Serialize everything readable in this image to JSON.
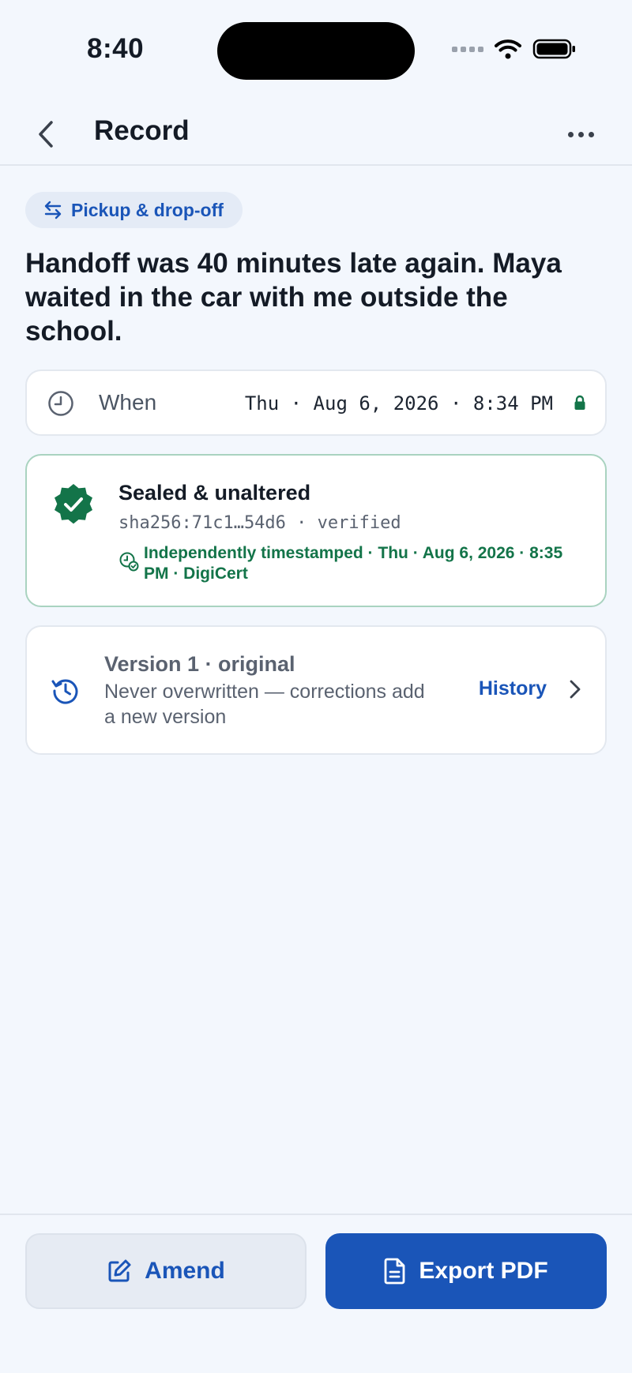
{
  "status_bar": {
    "time": "8:40"
  },
  "nav": {
    "title": "Record"
  },
  "record": {
    "category": "Pickup & drop-off",
    "headline": "Handoff was 40 minutes late again. Maya waited in the car with me outside the school."
  },
  "when": {
    "label": "When",
    "value": "Thu · Aug 6, 2026 · 8:34 PM"
  },
  "seal": {
    "title": "Sealed & unaltered",
    "hash": "sha256:71c1…54d6 · verified",
    "timestamp": "Independently timestamped · Thu · Aug 6, 2026 · 8:35 PM · DigiCert"
  },
  "version": {
    "title": "Version 1 · original",
    "description": "Never overwritten — corrections add a new version",
    "history_label": "History"
  },
  "actions": {
    "amend_label": "Amend",
    "export_label": "Export PDF"
  },
  "colors": {
    "accent": "#1A55B8",
    "success": "#137449",
    "background": "#F3F7FD"
  }
}
